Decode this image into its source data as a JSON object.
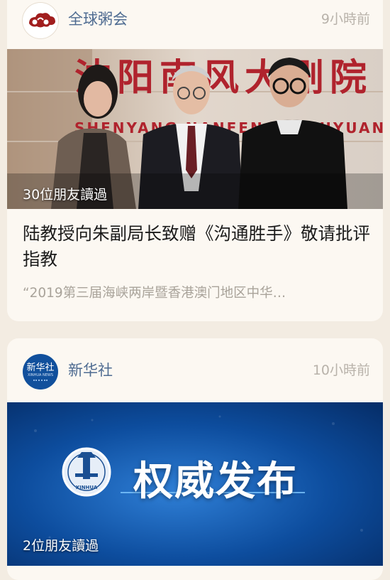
{
  "feed": [
    {
      "source": "全球粥会",
      "time": "9小時前",
      "avatar_icon": "zhouhui-cloud-logo-icon",
      "photo_sign_text": "沈阳南风大剧院",
      "photo_sign_pinyin": "SHENYANG NANFENG DAJUYUAN",
      "readers": "30位朋友讀過",
      "title": "陆教授向朱副局长致赠《沟通胜手》敬请批评指教",
      "desc": "“2019第三届海峡两岸暨香港澳门地区中华…"
    },
    {
      "source": "新华社",
      "time": "10小時前",
      "avatar_text": "新华社",
      "avatar_sub": "XINHUA NEWS",
      "banner_text": "权威发布",
      "emblem_text": "XINHUA",
      "readers": "2位朋友讀過"
    }
  ],
  "colors": {
    "background": "#f3ece2",
    "card": "#fcf8f2",
    "source_link": "#4e6b91",
    "time": "#b8b2aa",
    "banner_blue": "#0b4fa0"
  }
}
